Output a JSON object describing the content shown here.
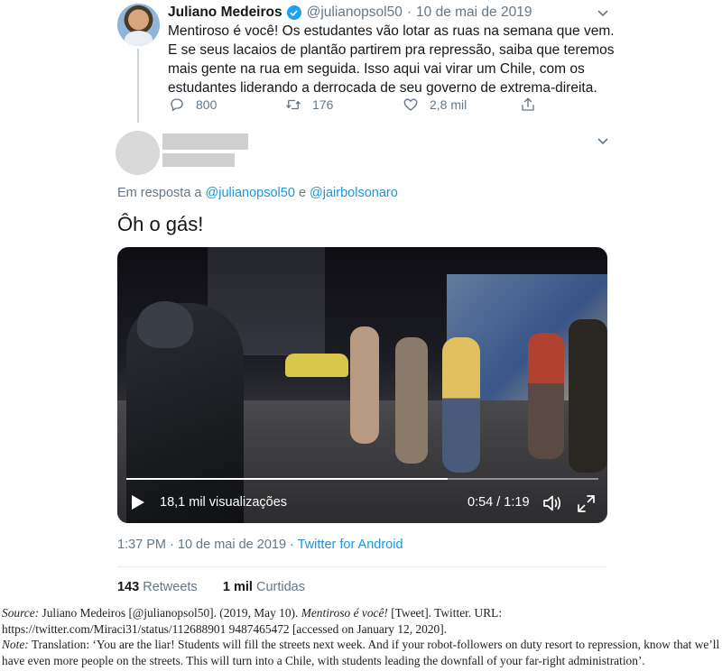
{
  "tweet": {
    "author_name": "Juliano Medeiros",
    "handle": "@julianopsol50",
    "separator": "·",
    "date": "10 de mai de 2019",
    "text": "Mentiroso é você! Os estudantes vão lotar as ruas na semana que vem. E se seus lacaios de plantão partirem pra repressão, saiba que teremos mais gente na rua em seguida. Isso aqui vai virar um Chile, com os estudantes liderando a derrocada de seu governo de extrema-direita.",
    "reply_count": "800",
    "retweet_count": "176",
    "like_count": "2,8 mil",
    "icons": {
      "reply": "reply-icon",
      "retweet": "retweet-icon",
      "like": "heart-icon",
      "share": "share-icon",
      "verified": "verified-badge-icon",
      "menu": "chevron-down-icon"
    }
  },
  "reply": {
    "in_reply_prefix": "Em resposta a",
    "in_reply_handle1": "@julianopsol50",
    "in_reply_and": "e",
    "in_reply_handle2": "@jairbolsonaro",
    "text": "Ôh o gás!",
    "video": {
      "views": "18,1 mil visualizações",
      "time": "0:54 / 1:19",
      "progress": 0.68
    },
    "timestamp": "1:37 PM · 10 de mai de 2019 ·",
    "client": "Twitter for Android",
    "retweets_count": "143",
    "retweets_label": "Retweets",
    "likes_count": "1 mil",
    "likes_label": "Curtidas"
  },
  "caption": {
    "source_label": "Source:",
    "source_text_1": " Juliano Medeiros [@julianopsol50]. (2019, May 10). ",
    "source_title": "Mentiroso é você!",
    "source_text_2": " [Tweet]. Twitter. URL: https://twitter.com/Miraci31/status/112688901 9487465472 [accessed on January 12, 2020].",
    "note_label": "Note:",
    "note_text": " Translation: ‘You are the liar! Students will fill the streets next week. And if your robot-followers on duty resort to repression, know that we’ll have even more people on the streets. This will turn into a Chile, with students leading the downfall of your far-right administration’."
  },
  "colors": {
    "link": "#1b95e0",
    "muted": "#657786",
    "text": "#14171a",
    "verified": "#1da1f2"
  }
}
